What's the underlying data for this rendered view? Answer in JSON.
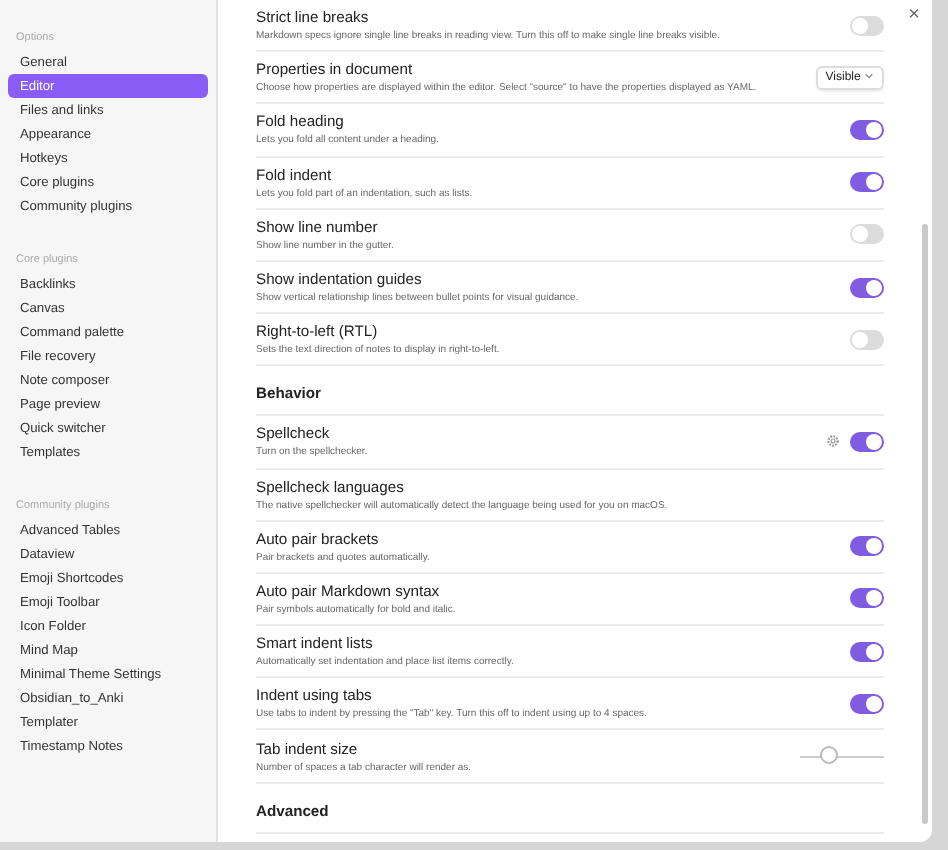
{
  "sidebar": {
    "sections": [
      {
        "heading": "Options",
        "items": [
          {
            "label": "General",
            "selected": false
          },
          {
            "label": "Editor",
            "selected": true
          },
          {
            "label": "Files and links",
            "selected": false
          },
          {
            "label": "Appearance",
            "selected": false
          },
          {
            "label": "Hotkeys",
            "selected": false
          },
          {
            "label": "Core plugins",
            "selected": false
          },
          {
            "label": "Community plugins",
            "selected": false
          }
        ]
      },
      {
        "heading": "Core plugins",
        "items": [
          {
            "label": "Backlinks",
            "selected": false
          },
          {
            "label": "Canvas",
            "selected": false
          },
          {
            "label": "Command palette",
            "selected": false
          },
          {
            "label": "File recovery",
            "selected": false
          },
          {
            "label": "Note composer",
            "selected": false
          },
          {
            "label": "Page preview",
            "selected": false
          },
          {
            "label": "Quick switcher",
            "selected": false
          },
          {
            "label": "Templates",
            "selected": false
          }
        ]
      },
      {
        "heading": "Community plugins",
        "items": [
          {
            "label": "Advanced Tables",
            "selected": false
          },
          {
            "label": "Dataview",
            "selected": false
          },
          {
            "label": "Emoji Shortcodes",
            "selected": false
          },
          {
            "label": "Emoji Toolbar",
            "selected": false
          },
          {
            "label": "Icon Folder",
            "selected": false
          },
          {
            "label": "Mind Map",
            "selected": false
          },
          {
            "label": "Minimal Theme Settings",
            "selected": false
          },
          {
            "label": "Obsidian_to_Anki",
            "selected": false
          },
          {
            "label": "Templater",
            "selected": false
          },
          {
            "label": "Timestamp Notes",
            "selected": false
          }
        ]
      }
    ]
  },
  "close": "×",
  "settings": [
    {
      "kind": "toggle",
      "name": "Strict line breaks",
      "description": "Markdown specs ignore single line breaks in reading view. Turn this off to make single line breaks visible.",
      "on": false
    },
    {
      "kind": "dropdown",
      "name": "Properties in document",
      "description": "Choose how properties are displayed within the editor. Select \"source\" to have the properties displayed as YAML.",
      "value": "Visible"
    },
    {
      "kind": "toggle",
      "name": "Fold heading",
      "description": "Lets you fold all content under a heading.",
      "on": true
    },
    {
      "kind": "toggle",
      "name": "Fold indent",
      "description": "Lets you fold part of an indentation, such as lists.",
      "on": true
    },
    {
      "kind": "toggle",
      "name": "Show line number",
      "description": "Show line number in the gutter.",
      "on": false
    },
    {
      "kind": "toggle",
      "name": "Show indentation guides",
      "description": "Show vertical relationship lines between bullet points for visual guidance.",
      "on": true
    },
    {
      "kind": "toggle",
      "name": "Right-to-left (RTL)",
      "description": "Sets the text direction of notes to display in right-to-left.",
      "on": false
    },
    {
      "kind": "heading",
      "name": "Behavior"
    },
    {
      "kind": "toggle-gear",
      "name": "Spellcheck",
      "description": "Turn on the spellchecker.",
      "on": true
    },
    {
      "kind": "info",
      "name": "Spellcheck languages",
      "description": "The native spellchecker will automatically detect the language being used for you on macOS."
    },
    {
      "kind": "toggle",
      "name": "Auto pair brackets",
      "description": "Pair brackets and quotes automatically.",
      "on": true
    },
    {
      "kind": "toggle",
      "name": "Auto pair Markdown syntax",
      "description": "Pair symbols automatically for bold and italic.",
      "on": true
    },
    {
      "kind": "toggle",
      "name": "Smart indent lists",
      "description": "Automatically set indentation and place list items correctly.",
      "on": true
    },
    {
      "kind": "toggle",
      "name": "Indent using tabs",
      "description": "Use tabs to indent by pressing the \"Tab\" key. Turn this off to indent using up to 4 spaces.",
      "on": true
    },
    {
      "kind": "slider",
      "name": "Tab indent size",
      "description": "Number of spaces a tab character will render as.",
      "level": 0.35
    },
    {
      "kind": "heading",
      "name": "Advanced"
    }
  ]
}
